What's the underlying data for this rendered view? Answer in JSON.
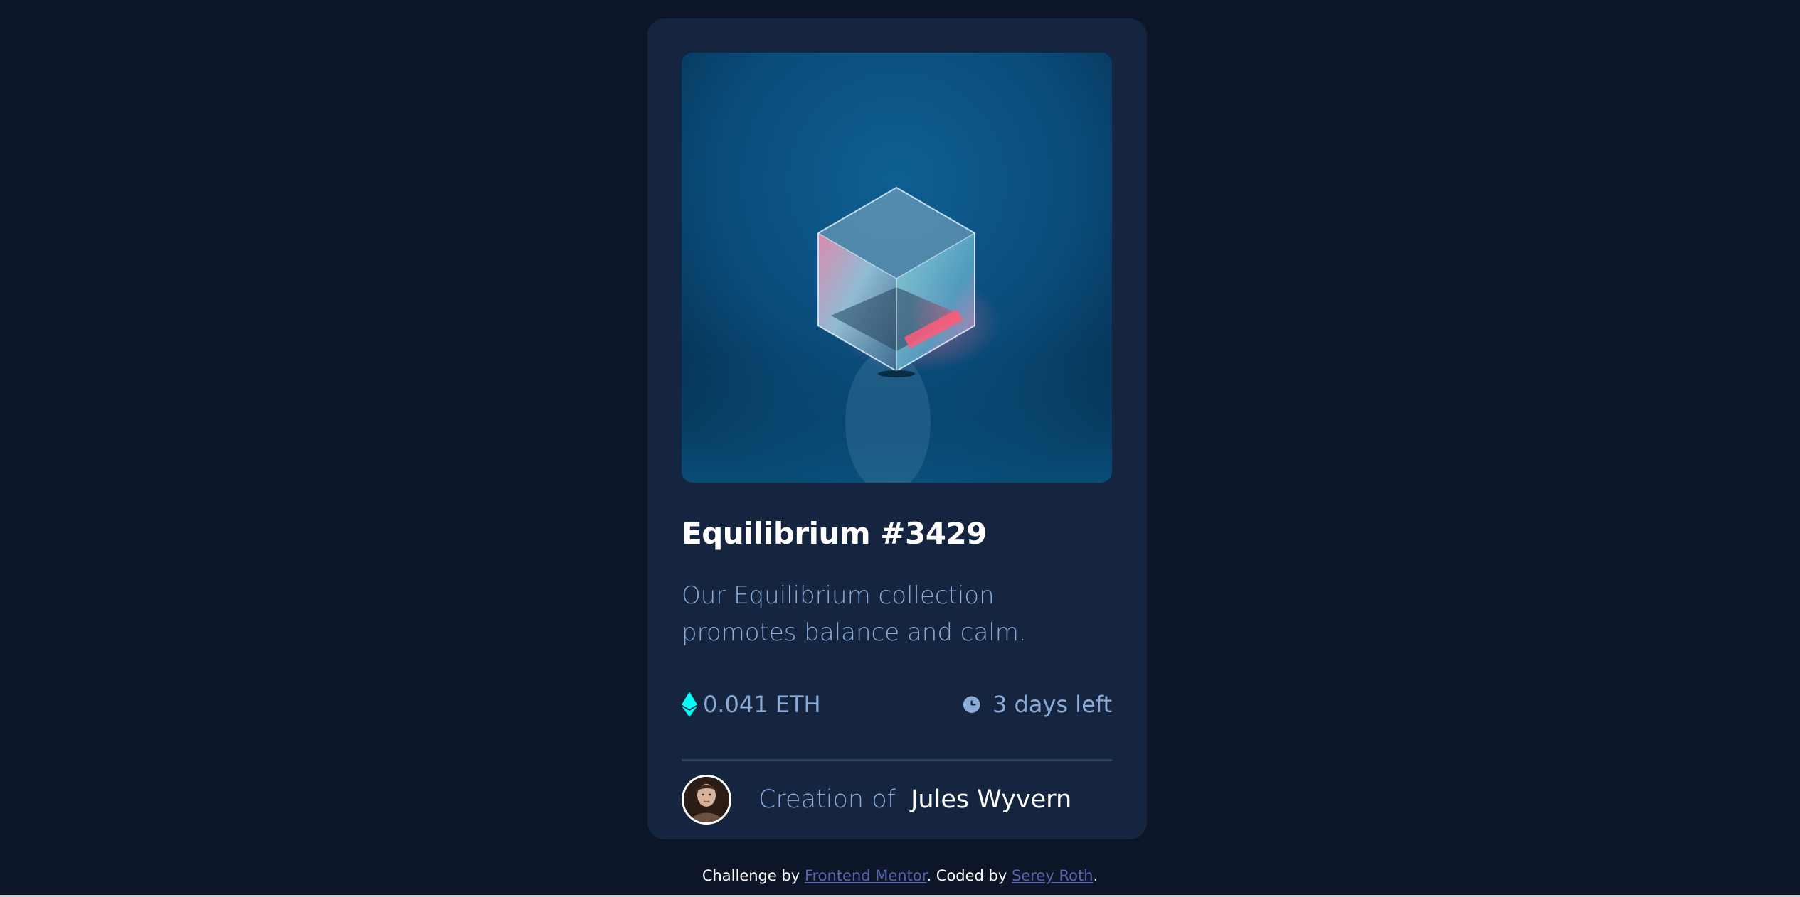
{
  "card": {
    "title": "Equilibrium #3429",
    "description": "Our Equilibrium collection promotes balance and calm.",
    "price": "0.041 ETH",
    "time_left": "3 days left",
    "creator_prefix": "Creation of",
    "creator_name": "Jules Wyvern",
    "image_alt": "Equilibrium",
    "avatar_alt": "Jules Wyvern"
  },
  "attribution": {
    "prefix": "Challenge by",
    "challenge_link": "Frontend Mentor",
    "middle": ". Coded by",
    "coder_link": "Serey Roth",
    "suffix": "."
  },
  "icons": {
    "price": "ethereum-icon",
    "time": "clock-icon"
  },
  "colors": {
    "background": "#0d1629",
    "card": "#15253f",
    "text_muted": "#8bacd9",
    "accent_cyan": "#00fff8",
    "white": "#ffffff",
    "link": "#5865a8"
  }
}
